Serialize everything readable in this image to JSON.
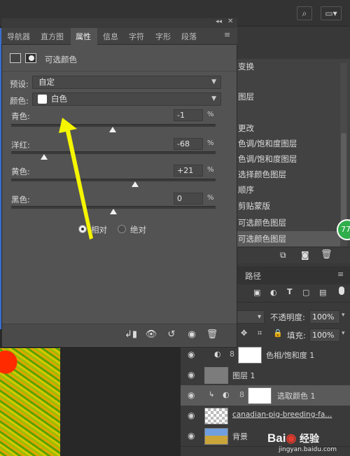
{
  "history": {
    "items": [
      "变换",
      "图层",
      "更改",
      "色调/饱和度图层",
      "色调/饱和度图层",
      "选择颜色图层",
      "顺序",
      "剪贴蒙版",
      "可选颜色图层",
      "可选颜色图层"
    ]
  },
  "properties": {
    "tabs": [
      "导航器",
      "直方图",
      "属性",
      "信息",
      "字符",
      "字形",
      "段落"
    ],
    "title": "可选颜色",
    "preset_label": "预设:",
    "preset_value": "自定",
    "colors_label": "颜色:",
    "colors_value": "白色",
    "sliders": [
      {
        "label": "青色:",
        "value": "-1",
        "unit": "%",
        "level": -1
      },
      {
        "label": "洋红:",
        "value": "-68",
        "unit": "%",
        "level": -68
      },
      {
        "label": "黄色:",
        "value": "+21",
        "unit": "%",
        "level": 21
      },
      {
        "label": "黑色:",
        "value": "0",
        "unit": "%",
        "level": 0
      }
    ],
    "method_relative": "相对",
    "method_absolute": "绝对"
  },
  "layers": {
    "tab_paths": "路径",
    "opacity_label": "不透明度:",
    "opacity_value": "100%",
    "fill_label": "填充:",
    "fill_value": "100%",
    "rows": [
      {
        "name": "色相/饱和度 1"
      },
      {
        "name": "图层 1"
      },
      {
        "name": "选取颜色 1"
      },
      {
        "name": "canadian-pig-breeding-fa..."
      },
      {
        "name": "背景"
      }
    ]
  },
  "watermark": {
    "brand": "Bai",
    "suffix": "经验",
    "url": "jingyan.baidu.com"
  },
  "badge": "77",
  "colors": {
    "panel": "#535353",
    "arrow": "#f5f500",
    "badge": "#2fae4a"
  }
}
